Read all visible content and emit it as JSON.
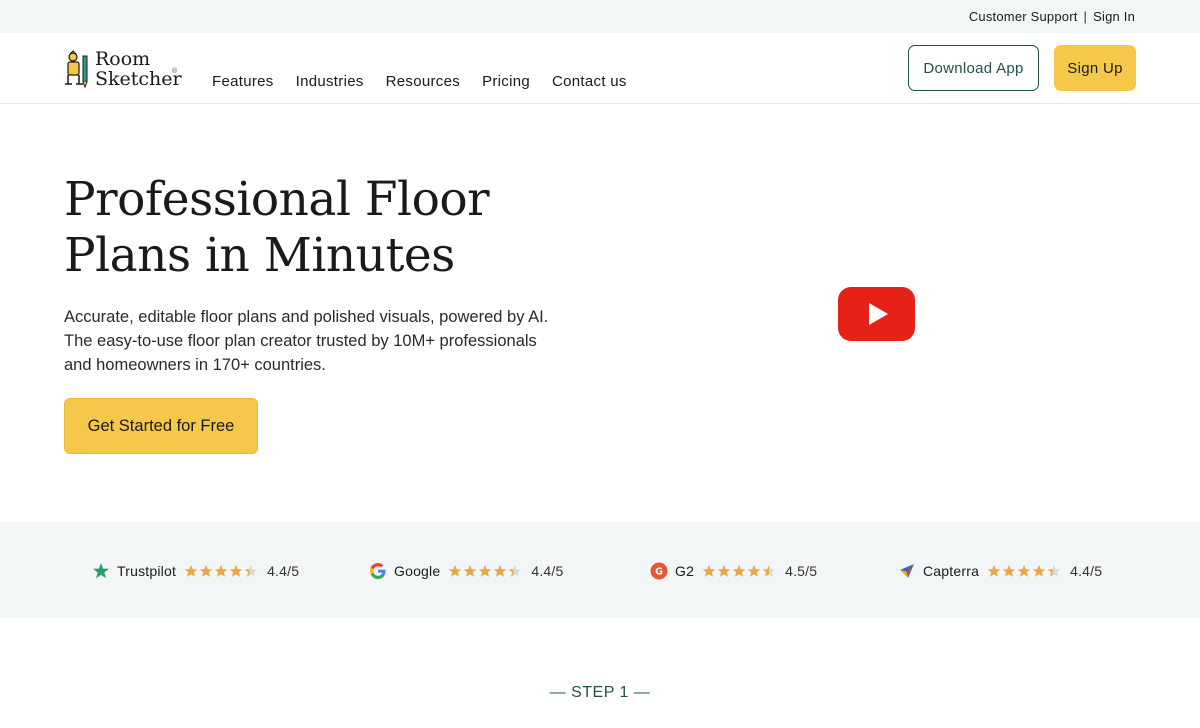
{
  "topbar": {
    "customer_support": "Customer Support",
    "separator": "|",
    "sign_in": "Sign In"
  },
  "logo": {
    "line1": "Room",
    "line2": "Sketcher",
    "registered": "®"
  },
  "nav": {
    "items": [
      "Features",
      "Industries",
      "Resources",
      "Pricing",
      "Contact us"
    ]
  },
  "header_buttons": {
    "download": "Download App",
    "signup": "Sign Up"
  },
  "hero": {
    "title_line1": "Professional Floor",
    "title_line2": "Plans in Minutes",
    "desc_line1": "Accurate, editable floor plans and polished visuals, powered by AI.",
    "desc_line2": "The easy-to-use floor plan creator trusted by 10M+ professionals",
    "desc_line3": "and homeowners in 170+ countries.",
    "cta": "Get Started for Free"
  },
  "video": {
    "icon": "youtube-play-icon",
    "color": "#e62117"
  },
  "ratings": [
    {
      "name": "Trustpilot",
      "icon": "trustpilot-icon",
      "score": "4.4/5",
      "stars": 4.4
    },
    {
      "name": "Google",
      "icon": "google-icon",
      "score": "4.4/5",
      "stars": 4.4
    },
    {
      "name": "G2",
      "icon": "g2-icon",
      "score": "4.5/5",
      "stars": 4.5
    },
    {
      "name": "Capterra",
      "icon": "capterra-icon",
      "score": "4.4/5",
      "stars": 4.4
    }
  ],
  "step": {
    "label": "— STEP 1 —"
  },
  "colors": {
    "accent_yellow": "#f5c84a",
    "brand_teal": "#22504c",
    "star": "#e8a84a",
    "band": "#f3f6f6"
  }
}
